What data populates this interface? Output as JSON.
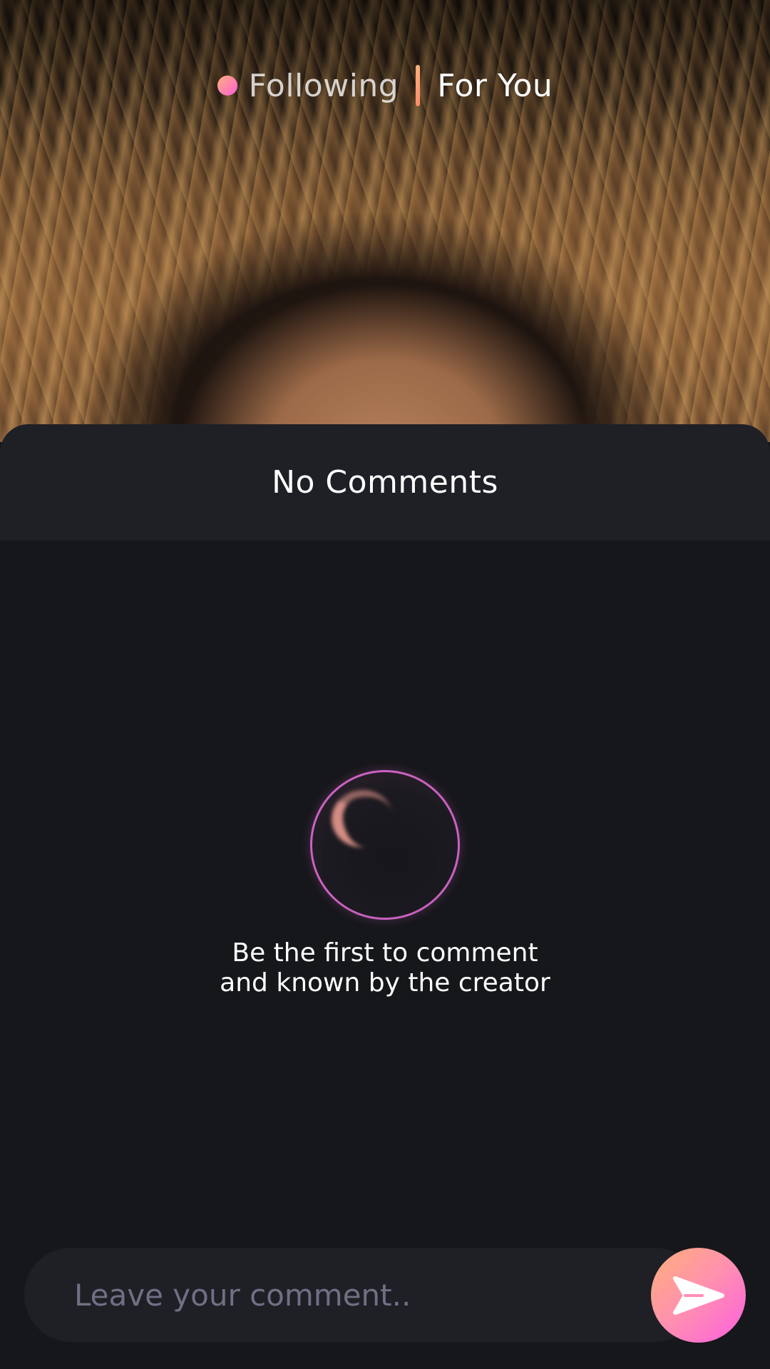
{
  "header": {
    "tabs": [
      {
        "label": "Following",
        "active": false
      },
      {
        "label": "For You",
        "active": true
      }
    ]
  },
  "comments": {
    "title": "No Comments",
    "empty_state": {
      "line1": "Be the first to comment",
      "line2": "and known by the creator"
    }
  },
  "composer": {
    "placeholder": "Leave your comment..",
    "value": ""
  },
  "icons": {
    "live": "live-dot-icon",
    "empty": "bubble-icon",
    "send": "send-icon"
  },
  "colors": {
    "accent_start": "#ffb07a",
    "accent_end": "#ff5fd6",
    "sheet_bg": "#16171b",
    "panel_bg": "#1f2026"
  }
}
